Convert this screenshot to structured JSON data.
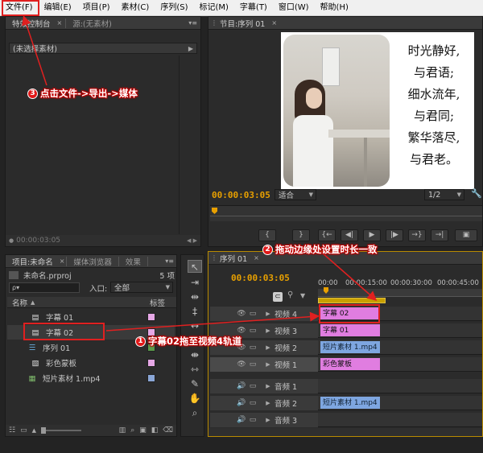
{
  "menu": [
    "文件(F)",
    "编辑(E)",
    "项目(P)",
    "素材(C)",
    "序列(S)",
    "标记(M)",
    "字幕(T)",
    "窗口(W)",
    "帮助(H)"
  ],
  "effect_controls": {
    "tab_active": "特效控制台",
    "tab_source": "源:(无素材)",
    "no_clip": "(未选择素材)",
    "timecode": "00:00:03:05"
  },
  "program": {
    "tab": "节目:序列 01",
    "timecode": "00:00:03:05",
    "fit": "适合",
    "page": "1/2",
    "poem": [
      "时光静好,",
      "与君语;",
      "细水流年,",
      "与君同;",
      "繁华落尽,",
      "与君老。"
    ]
  },
  "project": {
    "tabs": [
      "项目:未命名",
      "媒体浏览器",
      "效果"
    ],
    "file": "未命名.prproj",
    "count": "5 项",
    "search_placeholder": "ρ▾",
    "in_label": "入口:",
    "in_value": "全部",
    "col_name": "名称",
    "col_label": "标签",
    "items": [
      {
        "name": "字幕 01",
        "color": "#e6a8e6"
      },
      {
        "name": "字幕 02",
        "color": "#e6a8e6"
      },
      {
        "name": "序列 01",
        "color": "#5a9a4a"
      },
      {
        "name": "彩色蒙板",
        "color": "#e6a8e6"
      },
      {
        "name": "短片素材 1.mp4",
        "color": "#8aa6d6"
      }
    ]
  },
  "timeline": {
    "tab": "序列 01",
    "timecode": "00:00:03:05",
    "ruler": [
      "00:00",
      "00:00:15:00",
      "00:00:30:00",
      "00:00:45:00"
    ],
    "tracks": [
      {
        "name": "视频 4",
        "clip": "字幕 02"
      },
      {
        "name": "视频 3",
        "clip": "字幕 01"
      },
      {
        "name": "视频 2",
        "clip": "短片素材 1.mp4 [视"
      },
      {
        "name": "视频 1",
        "clip": "彩色蒙板"
      },
      {
        "name": "音频 1",
        "clip": ""
      },
      {
        "name": "音频 2",
        "clip": "短片素材 1.mp4 [音"
      },
      {
        "name": "音频 3",
        "clip": ""
      }
    ]
  },
  "callouts": {
    "c1_num": "1",
    "c1": "字幕02拖至视频4轨道",
    "c2_num": "2",
    "c2": "拖动边缘处设置时长一致",
    "c3_num": "3",
    "c3": "点击文件->导出->媒体"
  }
}
